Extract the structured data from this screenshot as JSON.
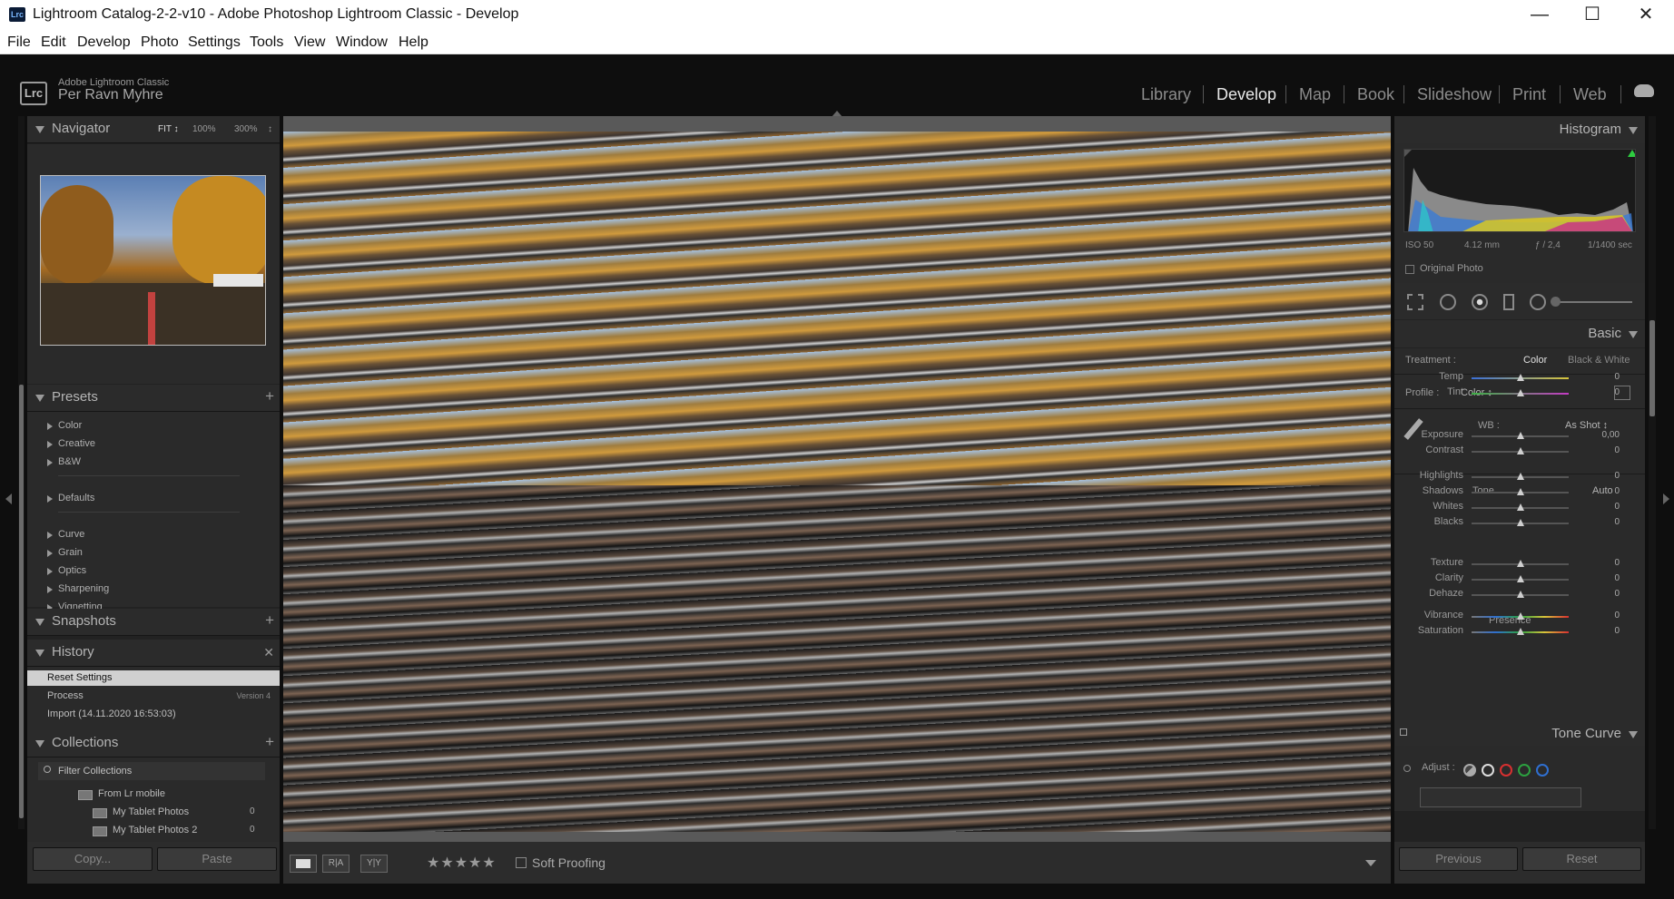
{
  "window": {
    "title": "Lightroom Catalog-2-2-v10 - Adobe Photoshop Lightroom Classic - Develop",
    "app_icon": "Lrc",
    "minimize": "—",
    "maximize": "☐",
    "close": "✕"
  },
  "menu": [
    "File",
    "Edit",
    "Develop",
    "Photo",
    "Settings",
    "Tools",
    "View",
    "Window",
    "Help"
  ],
  "identity": {
    "logo": "Lrc",
    "product": "Adobe Lightroom Classic",
    "user": "Per Ravn Myhre"
  },
  "modules": [
    "Library",
    "Develop",
    "Map",
    "Book",
    "Slideshow",
    "Print",
    "Web"
  ],
  "active_module": "Develop",
  "navigator": {
    "title": "Navigator",
    "zoom": [
      "FIT ↕",
      "100%",
      "300%",
      "↕"
    ]
  },
  "presets": {
    "title": "Presets",
    "add": "+",
    "groups1": [
      "Color",
      "Creative",
      "B&W"
    ],
    "groups2": [
      "Defaults"
    ],
    "groups3": [
      "Curve",
      "Grain",
      "Optics",
      "Sharpening",
      "Vignetting"
    ]
  },
  "snapshots": {
    "title": "Snapshots",
    "add": "+"
  },
  "history": {
    "title": "History",
    "clear": "✕",
    "items": [
      {
        "label": "Reset Settings",
        "detail": ""
      },
      {
        "label": "Process",
        "detail": "Version 4"
      },
      {
        "label": "Import (14.11.2020 16:53:03)",
        "detail": ""
      }
    ]
  },
  "collections": {
    "title": "Collections",
    "add": "+",
    "filter": "Filter Collections",
    "group": "From Lr mobile",
    "items": [
      {
        "name": "My Tablet Photos",
        "count": "0"
      },
      {
        "name": "My Tablet Photos 2",
        "count": "0"
      }
    ]
  },
  "left_buttons": {
    "copy": "Copy...",
    "paste": "Paste"
  },
  "toolbar": {
    "stars": "★★★★★",
    "soft_proofing": "Soft Proofing",
    "view_compare": "R|A",
    "view_before": "Y|Y"
  },
  "histogram": {
    "title": "Histogram",
    "iso": "ISO 50",
    "focal": "4.12 mm",
    "aperture": "ƒ / 2,4",
    "shutter": "1/1400 sec",
    "original_photo": "Original Photo"
  },
  "basic": {
    "title": "Basic",
    "treatment_label": "Treatment :",
    "treatment_color": "Color",
    "treatment_bw": "Black & White",
    "profile_label": "Profile :",
    "profile_value": "Color ↕",
    "wb_label": "WB :",
    "wb_value": "As Shot ↕",
    "tone_label": "Tone",
    "auto": "Auto",
    "presence_label": "Presence",
    "sliders": [
      {
        "name": "Temp",
        "value": "0",
        "pos": 0.5
      },
      {
        "name": "Tint",
        "value": "0",
        "pos": 0.5
      },
      {
        "name": "Exposure",
        "value": "0,00",
        "pos": 0.5
      },
      {
        "name": "Contrast",
        "value": "0",
        "pos": 0.5
      },
      {
        "name": "Highlights",
        "value": "0",
        "pos": 0.5
      },
      {
        "name": "Shadows",
        "value": "0",
        "pos": 0.5
      },
      {
        "name": "Whites",
        "value": "0",
        "pos": 0.5
      },
      {
        "name": "Blacks",
        "value": "0",
        "pos": 0.5
      },
      {
        "name": "Texture",
        "value": "0",
        "pos": 0.5
      },
      {
        "name": "Clarity",
        "value": "0",
        "pos": 0.5
      },
      {
        "name": "Dehaze",
        "value": "0",
        "pos": 0.5
      },
      {
        "name": "Vibrance",
        "value": "0",
        "pos": 0.5
      },
      {
        "name": "Saturation",
        "value": "0",
        "pos": 0.5
      }
    ]
  },
  "tone_curve": {
    "title": "Tone Curve",
    "adjust": "Adjust :"
  },
  "right_buttons": {
    "previous": "Previous",
    "reset": "Reset"
  },
  "colors": {
    "accent_bg": "#222222",
    "selected_row": "#d0d0d0",
    "hist_green": "#2ecc40"
  }
}
